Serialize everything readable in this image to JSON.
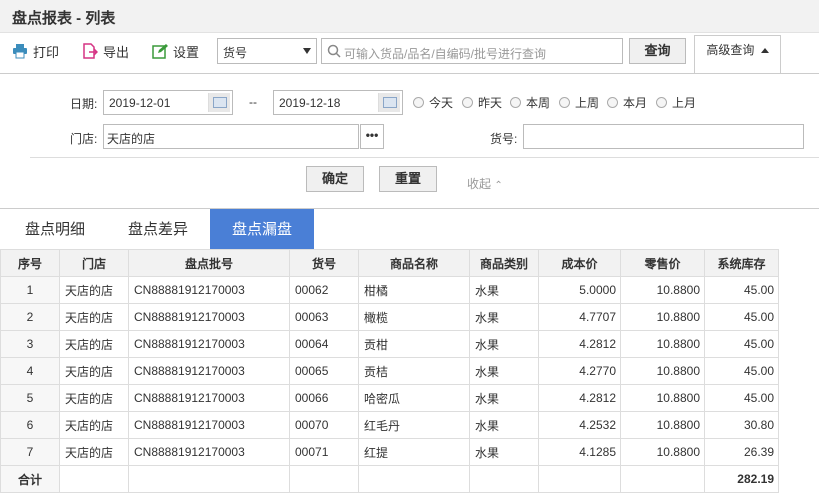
{
  "header": {
    "title": "盘点报表 - 列表"
  },
  "toolbar": {
    "print_label": "打印",
    "export_label": "导出",
    "settings_label": "设置",
    "field_select_value": "货号",
    "search_placeholder": "可输入货品/品名/自编码/批号进行查询",
    "query_label": "查询",
    "advanced_label": "高级查询"
  },
  "filter": {
    "date_label": "日期:",
    "date_from": "2019-12-01",
    "date_sep": "--",
    "date_to": "2019-12-18",
    "quick_dates": [
      "今天",
      "昨天",
      "本周",
      "上周",
      "本月",
      "上月"
    ],
    "store_label": "门店:",
    "store_value": "天店的店",
    "more_label": "•••",
    "goods_label": "货号:",
    "goods_value": "",
    "confirm_label": "确定",
    "reset_label": "重置",
    "collapse_label": "收起"
  },
  "tabs": [
    "盘点明细",
    "盘点差异",
    "盘点漏盘"
  ],
  "active_tab": 2,
  "table": {
    "columns": [
      "序号",
      "门店",
      "盘点批号",
      "货号",
      "商品名称",
      "商品类别",
      "成本价",
      "零售价",
      "系统库存"
    ],
    "rows": [
      [
        "1",
        "天店的店",
        "CN88881912170003",
        "00062",
        "柑橘",
        "水果",
        "5.0000",
        "10.8800",
        "45.00"
      ],
      [
        "2",
        "天店的店",
        "CN88881912170003",
        "00063",
        "橄榄",
        "水果",
        "4.7707",
        "10.8800",
        "45.00"
      ],
      [
        "3",
        "天店的店",
        "CN88881912170003",
        "00064",
        "贡柑",
        "水果",
        "4.2812",
        "10.8800",
        "45.00"
      ],
      [
        "4",
        "天店的店",
        "CN88881912170003",
        "00065",
        "贡桔",
        "水果",
        "4.2770",
        "10.8800",
        "45.00"
      ],
      [
        "5",
        "天店的店",
        "CN88881912170003",
        "00066",
        "哈密瓜",
        "水果",
        "4.2812",
        "10.8800",
        "45.00"
      ],
      [
        "6",
        "天店的店",
        "CN88881912170003",
        "00070",
        "红毛丹",
        "水果",
        "4.2532",
        "10.8800",
        "30.80"
      ],
      [
        "7",
        "天店的店",
        "CN88881912170003",
        "00071",
        "红提",
        "水果",
        "4.1285",
        "10.8800",
        "26.39"
      ]
    ],
    "total_label": "合计",
    "total_stock": "282.19"
  },
  "colors": {
    "accent": "#4a7fd6",
    "header_bg": "#f2f2f2"
  }
}
